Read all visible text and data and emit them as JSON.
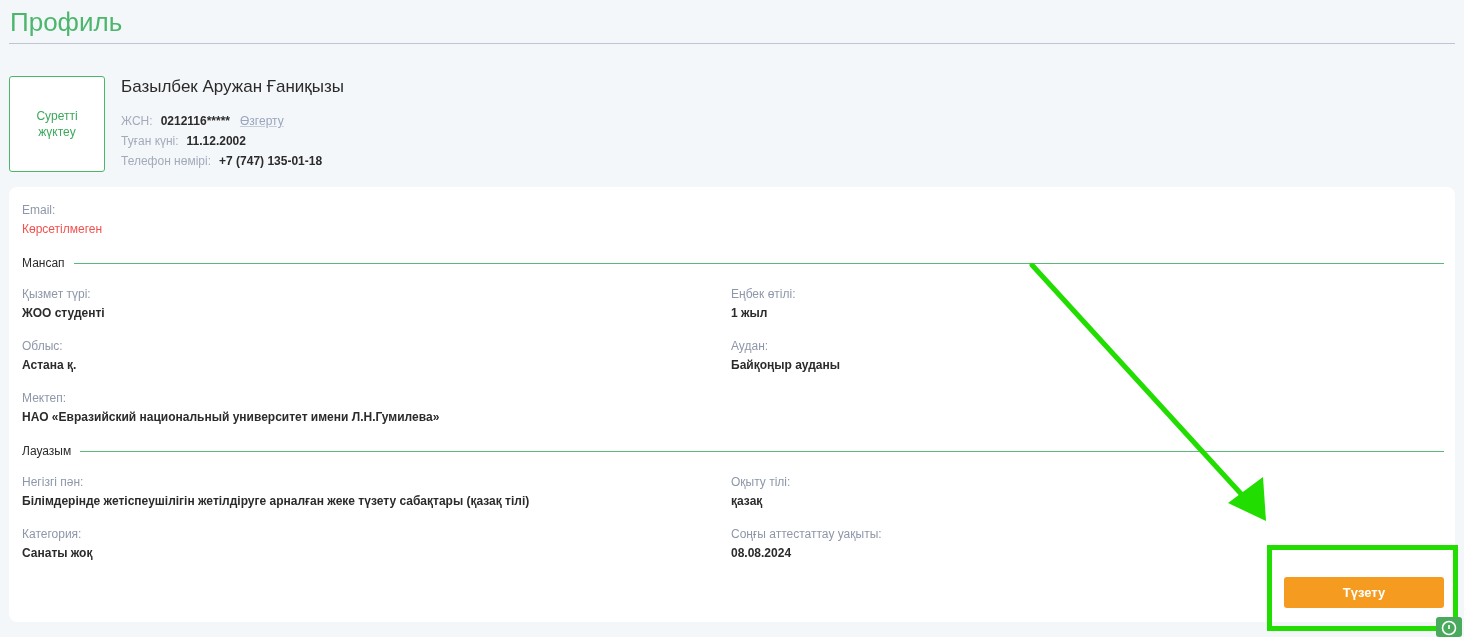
{
  "page": {
    "title": "Профиль"
  },
  "profile": {
    "photo_upload": "Суретті жүктеу",
    "name": "Базылбек Аружан Ғаниқызы",
    "details": [
      {
        "label": "ЖСН:",
        "value": "0212116*****",
        "action": "Өзгерту"
      },
      {
        "label": "Туған күні:",
        "value": "11.12.2002"
      },
      {
        "label": "Телефон нөмірі:",
        "value": "+7 (747) 135-01-18"
      }
    ]
  },
  "contact": {
    "label": "Email:",
    "value": "Көрсетілмеген",
    "missing": true
  },
  "sections": [
    {
      "title": "Мансап",
      "fields": [
        {
          "label": "Қызмет түрі:",
          "value": "ЖОО студенті"
        },
        {
          "label": "Еңбек өтілі:",
          "value": "1 жыл"
        },
        {
          "label": "Облыс:",
          "value": "Астана қ."
        },
        {
          "label": "Аудан:",
          "value": "Байқоңыр ауданы"
        },
        {
          "label": "Мектеп:",
          "value": "НАО «Евразийский национальный университет имени Л.Н.Гумилева»"
        }
      ]
    },
    {
      "title": "Лауазым",
      "fields": [
        {
          "label": "Негізгі пән:",
          "value": "Білімдерінде жетіспеушілігін жетілдіруге арналған жеке түзету сабақтары (қазақ тілі)"
        },
        {
          "label": "Оқыту тілі:",
          "value": "қазақ"
        },
        {
          "label": "Категория:",
          "value": "Санаты жоқ"
        },
        {
          "label": "Соңғы аттестаттау уақыты:",
          "value": "08.08.2024"
        }
      ]
    }
  ],
  "edit_button": {
    "label": "Түзету"
  },
  "annotation": {
    "arrow": true,
    "frame": true
  }
}
